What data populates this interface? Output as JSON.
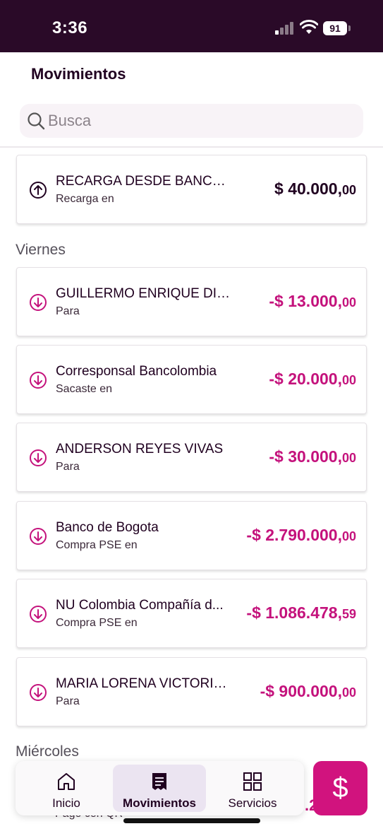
{
  "status_bar": {
    "time": "3:36",
    "battery": "91"
  },
  "header": {
    "title": "Movimientos"
  },
  "search": {
    "placeholder": "Busca"
  },
  "colors": {
    "accent": "#c4127c",
    "status_bar_bg": "#2a0a28",
    "fab_bg": "#d1137e",
    "nav_active_bg": "#ebe4f1"
  },
  "top_transaction": {
    "icon": "arrow-up-circle-icon",
    "title": "RECARGA DESDE BANCOL...",
    "subtitle": "Recarga en",
    "amount_main": "$ 40.000,",
    "amount_cents": "00"
  },
  "sections": [
    {
      "label": "Viernes",
      "transactions": [
        {
          "icon": "arrow-down-circle-icon",
          "title": "GUILLERMO ENRIQUE DIA...",
          "subtitle": "Para",
          "amount_main": "-$ 13.000,",
          "amount_cents": "00"
        },
        {
          "icon": "arrow-down-circle-icon",
          "title": "Corresponsal Bancolombia",
          "subtitle": "Sacaste en",
          "amount_main": "-$ 20.000,",
          "amount_cents": "00"
        },
        {
          "icon": "arrow-down-circle-icon",
          "title": "ANDERSON REYES VIVAS",
          "subtitle": "Para",
          "amount_main": "-$ 30.000,",
          "amount_cents": "00"
        },
        {
          "icon": "arrow-down-circle-icon",
          "title": "Banco de Bogota",
          "subtitle": "Compra PSE en",
          "amount_main": "-$ 2.790.000,",
          "amount_cents": "00"
        },
        {
          "icon": "arrow-down-circle-icon",
          "title": "NU Colombia Compañía d...",
          "subtitle": "Compra PSE en",
          "amount_main": "-$ 1.086.478,",
          "amount_cents": "59"
        },
        {
          "icon": "arrow-down-circle-icon",
          "title": "MARIA LORENA VICTORIA ...",
          "subtitle": "Para",
          "amount_main": "-$ 900.000,",
          "amount_cents": "00"
        }
      ]
    },
    {
      "label": "Miércoles"
    }
  ],
  "peek_row": {
    "subtitle": "Pago con QR",
    "amount": ".2"
  },
  "bottom_nav": {
    "items": [
      {
        "label": "Inicio",
        "icon": "home-icon"
      },
      {
        "label": "Movimientos",
        "icon": "receipt-icon"
      },
      {
        "label": "Servicios",
        "icon": "grid-icon"
      }
    ]
  },
  "fab": {
    "label": "$",
    "icon": "dollar-icon"
  }
}
